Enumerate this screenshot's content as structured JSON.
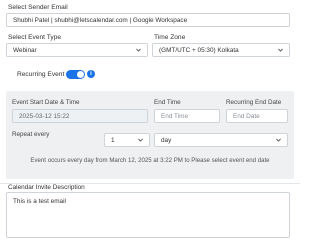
{
  "sender": {
    "label": "Select Sender Email",
    "value": "Shubhi Patel | shubhi@letscalendar.com | Google Workspace"
  },
  "event_type": {
    "label": "Select Event Type",
    "value": "Webinar"
  },
  "time_zone": {
    "label": "Time Zone",
    "value": "(GMT/UTC + 05:30)   Kolkata"
  },
  "recurring": {
    "label": "Recurring Event",
    "enabled": true
  },
  "recurrence": {
    "start_label": "Event Start Date & Time",
    "start_value": "2025-03-12 15:22",
    "end_time_label": "End Time",
    "end_time_placeholder": "End Time",
    "end_date_label": "Recurring End Date",
    "end_date_placeholder": "End Date",
    "repeat_label": "Repeat every",
    "repeat_count": "1",
    "repeat_unit": "day",
    "summary": "Event occurs every day from March 12, 2025 at 3:22 PM to Please select event end date"
  },
  "description": {
    "label": "Calendar Invite Description",
    "value": "This is a test email"
  },
  "colors": {
    "accent": "#1a73e8",
    "panel_bg": "#eef0f2",
    "border": "#cfd4da"
  }
}
